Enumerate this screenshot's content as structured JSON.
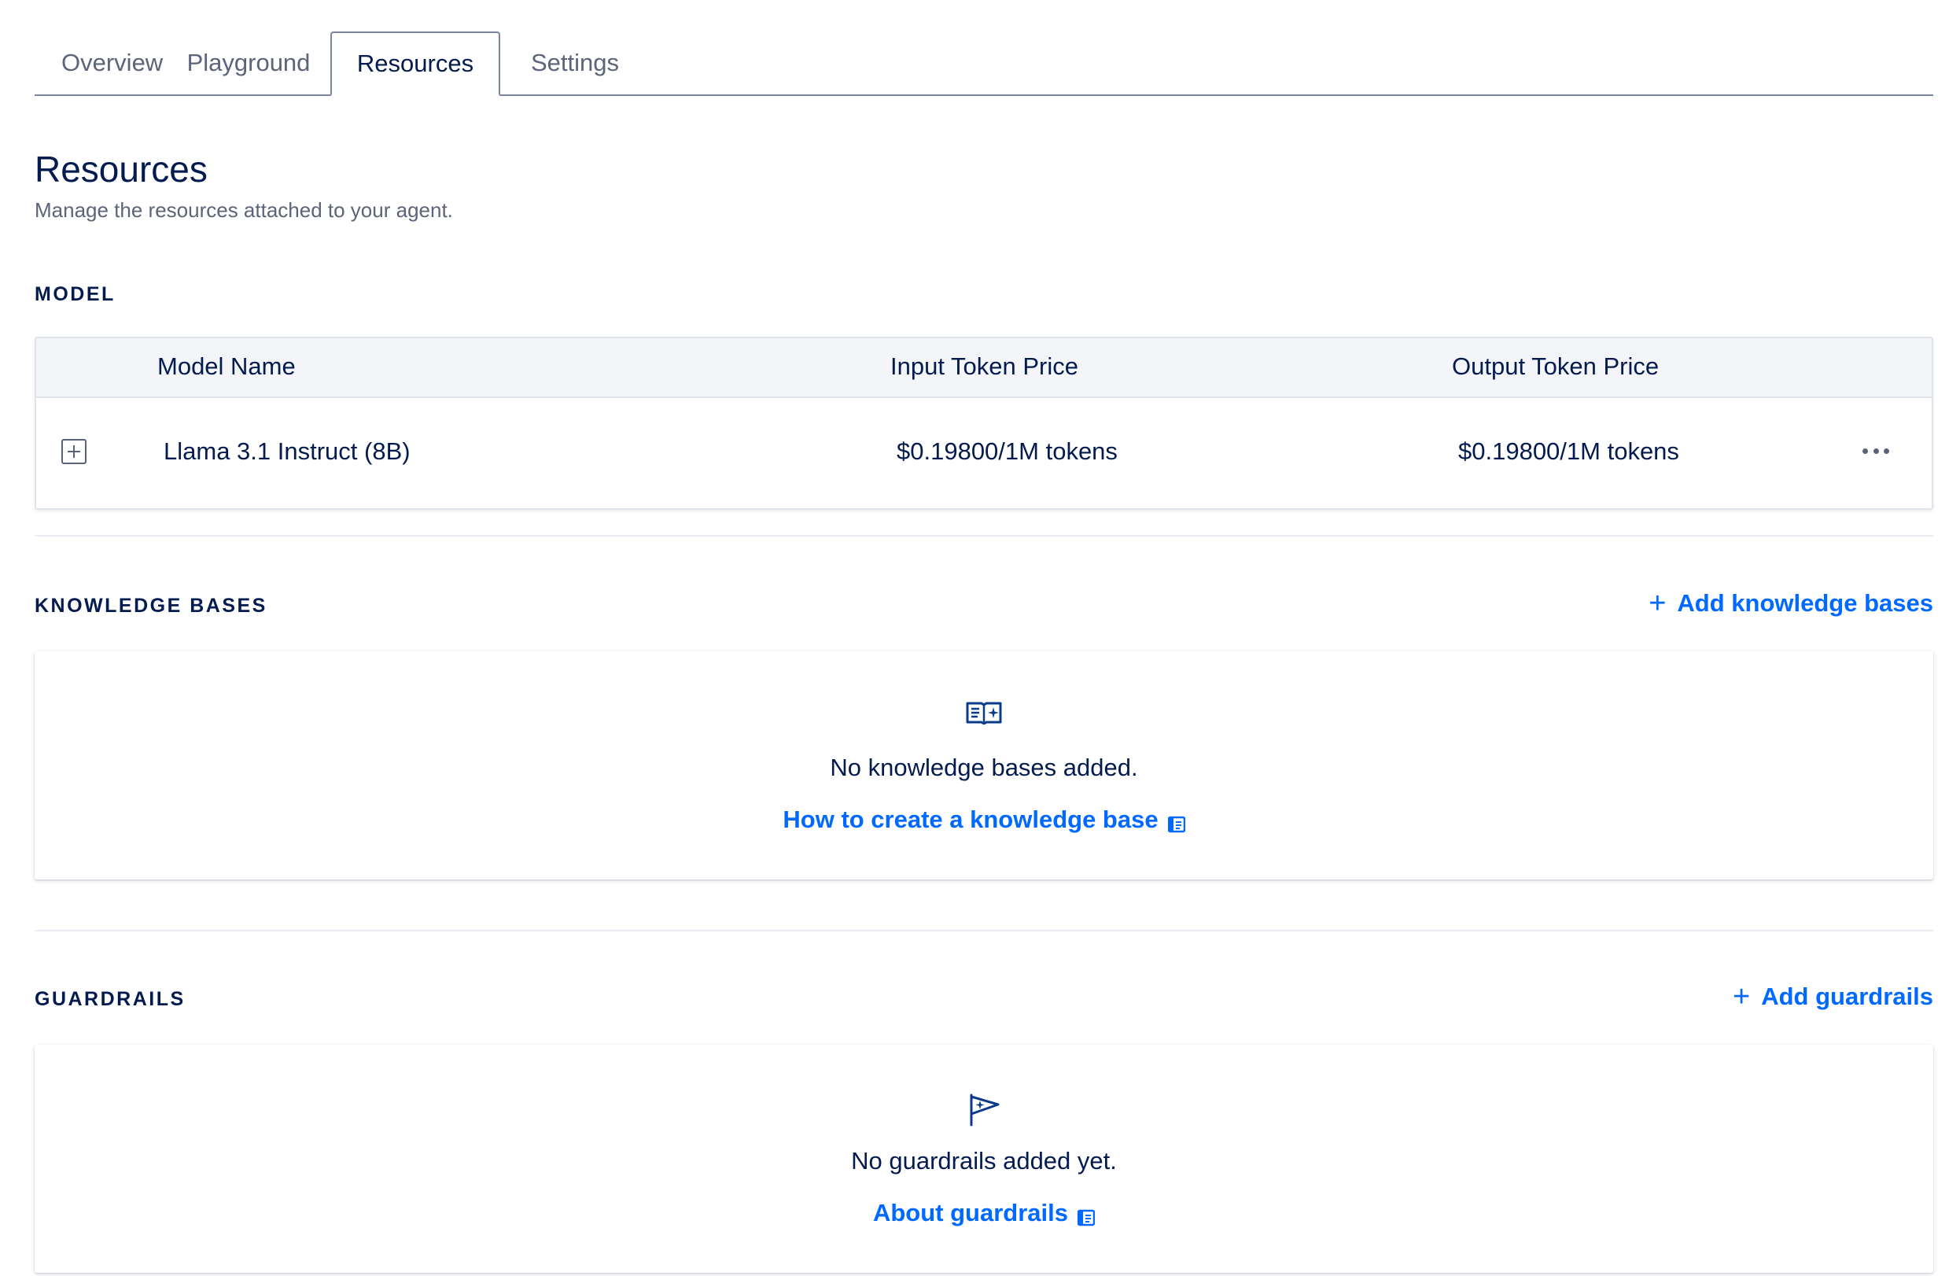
{
  "tabs": [
    {
      "label": "Overview",
      "active": false
    },
    {
      "label": "Playground",
      "active": false
    },
    {
      "label": "Resources",
      "active": true
    },
    {
      "label": "Settings",
      "active": false
    }
  ],
  "header": {
    "title": "Resources",
    "subtitle": "Manage the resources attached to your agent."
  },
  "model": {
    "section_label": "MODEL",
    "columns": [
      "Model Name",
      "Input Token Price",
      "Output Token Price"
    ],
    "rows": [
      {
        "name": "Llama 3.1 Instruct (8B)",
        "input_price": "$0.19800/1M tokens",
        "output_price": "$0.19800/1M tokens"
      }
    ]
  },
  "knowledge_bases": {
    "section_label": "KNOWLEDGE BASES",
    "add_label": "Add knowledge bases",
    "empty_message": "No knowledge bases added.",
    "doc_link_label": "How to create a knowledge base",
    "icon": "open-book-icon"
  },
  "guardrails": {
    "section_label": "GUARDRAILS",
    "add_label": "Add guardrails",
    "empty_message": "No guardrails added yet.",
    "doc_link_label": "About guardrails",
    "icon": "flag-icon"
  },
  "colors": {
    "text": "#031b4e",
    "muted": "#5b6478",
    "accent": "#0069ff",
    "table_header_bg": "#f3f5f9"
  }
}
